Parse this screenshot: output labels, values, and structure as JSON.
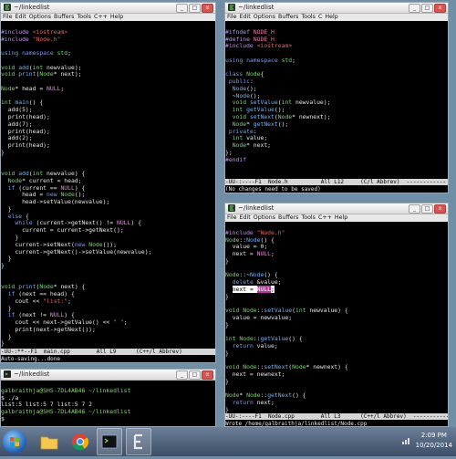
{
  "windows": {
    "main": {
      "title": "~/linkedlist",
      "menu": [
        "File",
        "Edit",
        "Options",
        "Buffers",
        "Tools",
        "C++",
        "Help"
      ],
      "modeline": "-UU-:**--F1  main.cpp        All L9      (C++/l Abbrev)",
      "echo": "Auto-saving...done"
    },
    "nodeh": {
      "title": "~/linkedlist",
      "menu": [
        "File",
        "Edit",
        "Options",
        "Buffers",
        "Tools",
        "C",
        "Help"
      ],
      "modeline": "-UU-:----F1  Node.h          All L12     (C/l Abbrev)  ------------",
      "echo": "(No changes need to be saved)"
    },
    "nodecpp": {
      "title": "~/linkedlist",
      "menu": [
        "File",
        "Edit",
        "Options",
        "Buffers",
        "Tools",
        "C++",
        "Help"
      ],
      "modeline": "-UU-:----F1  Node.cpp        All L3      (C++/l Abbrev)  ------------",
      "echo": "Wrote /home/galbraithja/linkedlist/Node.cpp"
    },
    "terminal": {
      "title": "~/linkedlist",
      "lines": [
        "galbraithja@SHS-7DL4AB46 ~/linkedlist",
        "$ ./a",
        "list:5 list:5 7 list:5 7 2",
        "galbraithja@SHS-7DL4AB46 ~/linkedlist",
        "$ "
      ]
    }
  },
  "window_controls": {
    "minimize": "_",
    "maximize": "□",
    "close": "x"
  },
  "taskbar": {
    "time": "2:09 PM",
    "date": "10/20/2014",
    "buttons": [
      "windows-explorer",
      "chrome",
      "terminal",
      "emacs"
    ]
  },
  "colors": {
    "desktop": "#6f8fa6",
    "taskbar": "#3d4e66",
    "editor_bg": "#000000",
    "keyword": "#7c9cf0",
    "type": "#7ad66f",
    "preprocessor": "#c88ff0",
    "string": "#e06464",
    "magenta": "#e38ad8"
  }
}
